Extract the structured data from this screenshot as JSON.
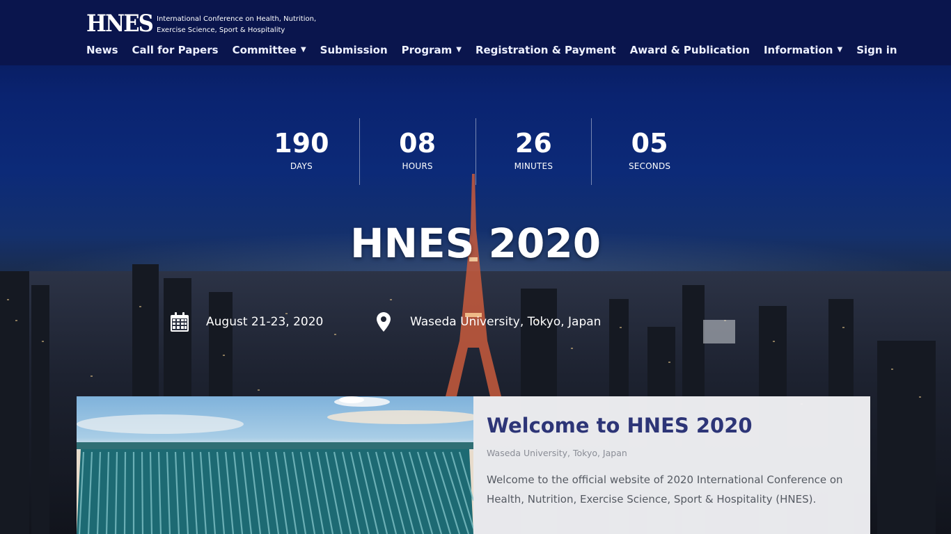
{
  "header": {
    "logo": "HNES",
    "tagline_line1": "International Conference on Health, Nutrition,",
    "tagline_line2": "Exercise Science, Sport & Hospitality",
    "nav": [
      {
        "label": "News",
        "dropdown": false
      },
      {
        "label": "Call for Papers",
        "dropdown": false
      },
      {
        "label": "Committee",
        "dropdown": true
      },
      {
        "label": "Submission",
        "dropdown": false
      },
      {
        "label": "Program",
        "dropdown": true
      },
      {
        "label": "Registration & Payment",
        "dropdown": false
      },
      {
        "label": "Award & Publication",
        "dropdown": false
      },
      {
        "label": "Information",
        "dropdown": true
      },
      {
        "label": "Sign in",
        "dropdown": false
      }
    ],
    "caret_glyph": "▼"
  },
  "countdown": {
    "days": {
      "value": "190",
      "label": "DAYS"
    },
    "hours": {
      "value": "08",
      "label": "HOURS"
    },
    "minutes": {
      "value": "26",
      "label": "MINUTES"
    },
    "seconds": {
      "value": "05",
      "label": "SECONDS"
    }
  },
  "hero": {
    "title": "HNES 2020",
    "date": "August 21-23, 2020",
    "venue": "Waseda University, Tokyo, Japan",
    "date_icon": "calendar-icon",
    "venue_icon": "map-pin-icon"
  },
  "welcome": {
    "title": "Welcome to HNES 2020",
    "subtitle": "Waseda University, Tokyo, Japan",
    "body": "Welcome to the official website of 2020 International Conference on Health, Nutrition, Exercise Science, Sport & Hospitality (HNES)."
  },
  "colors": {
    "header_bg": "#0a154d",
    "welcome_title": "#2d3577",
    "card_bg": "#f1f1f5"
  }
}
